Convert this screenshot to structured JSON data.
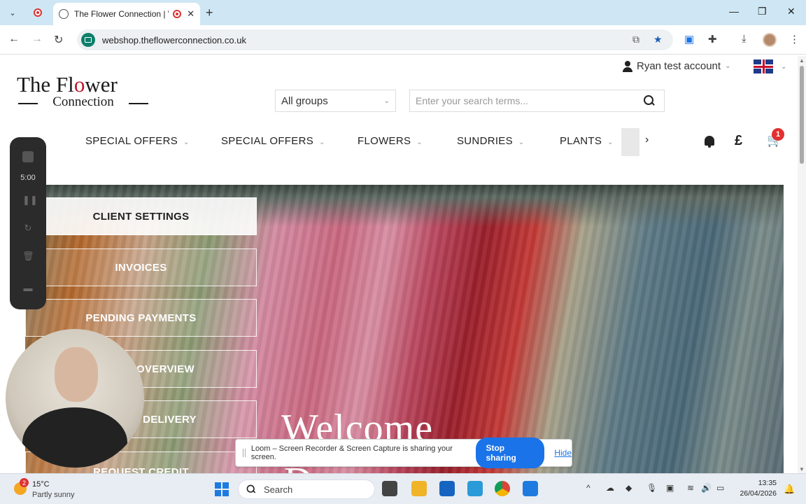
{
  "browser": {
    "tab_title": "The Flower Connection | W...",
    "url": "webshop.theflowerconnection.co.uk"
  },
  "header": {
    "logo_line1": "The Fl",
    "logo_line1_o": "o",
    "logo_line1_rest": "wer",
    "logo_line2": "Connection",
    "account_label": "Ryan test account",
    "groups_value": "All groups",
    "search_placeholder": "Enter your search terms...",
    "cart_count": "1",
    "currency": "£"
  },
  "menu": {
    "items": [
      "SPECIAL OFFERS",
      "SPECIAL OFFERS",
      "FLOWERS",
      "SUNDRIES",
      "PLANTS"
    ]
  },
  "hero": {
    "welcome": "Welcome",
    "welcome_line2": "D",
    "buttons": [
      "CLIENT SETTINGS",
      "INVOICES",
      "PENDING PAYMENTS",
      "OVERVIEW",
      "DELIVERY",
      "REQUEST CREDIT"
    ]
  },
  "loom": {
    "timer": "5:00",
    "share_text": "Loom – Screen Recorder & Screen Capture is sharing your screen.",
    "stop_label": "Stop sharing",
    "hide_label": "Hide"
  },
  "taskbar": {
    "weather_badge": "2",
    "temp": "15°C",
    "weather_desc": "Partly sunny",
    "search_label": "Search",
    "time": "13:35",
    "date": "26/04/2026"
  },
  "colors": {
    "accent_blue": "#1a73e8",
    "logo_red": "#c0152a",
    "badge_red": "#e23030"
  }
}
